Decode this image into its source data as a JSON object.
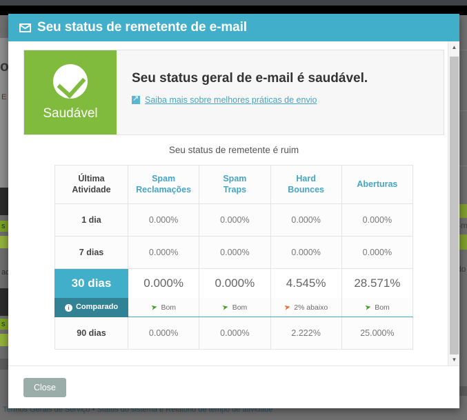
{
  "background": {
    "heading_fragment": "on",
    "sub_fragment": "E",
    "label_s1": "s",
    "label_s2": "s",
    "label_estado": "ade",
    "right_email_label": "E-m",
    "right_estado_label": "tado",
    "footer_text": "Termos Gerais de Serviço • Status do sistema e Relatório de tempo de atividade"
  },
  "modal": {
    "title": "Seu status de remetente de e-mail",
    "title_icon": "envelope-icon",
    "banner": {
      "badge_label": "Saudável",
      "badge_icon": "check-circle-icon",
      "badge_color": "#80bb3e",
      "headline": "Seu status geral de e-mail é saudável.",
      "link_text": "Saiba mais sobre melhores práticas de envio",
      "link_icon": "external-link-icon"
    },
    "sub_status": "Seu status de remetente é ruim",
    "table": {
      "headers": [
        "Última Atividade",
        "Spam Reclamações",
        "Spam Traps",
        "Hard Bounces",
        "Aberturas"
      ],
      "headers_split": [
        [
          "Última",
          "Atividade"
        ],
        [
          "Spam",
          "Reclamações"
        ],
        [
          "Spam",
          "Traps"
        ],
        [
          "Hard",
          "Bounces"
        ],
        [
          "Aberturas",
          ""
        ]
      ],
      "rows": [
        {
          "label": "1 dia",
          "values": [
            "0.000%",
            "0.000%",
            "0.000%",
            "0.000%"
          ]
        },
        {
          "label": "7 dias",
          "values": [
            "0.000%",
            "0.000%",
            "0.000%",
            "0.000%"
          ]
        },
        {
          "label": "30 dias",
          "values": [
            "0.000%",
            "0.000%",
            "4.545%",
            "28.571%"
          ],
          "highlight": true
        },
        {
          "label": "90 dias",
          "values": [
            "0.000%",
            "0.000%",
            "2.222%",
            "25.000%"
          ]
        }
      ],
      "compare_row": {
        "label": "Comparado",
        "label_icon": "info-circle-icon",
        "cells": [
          {
            "text": "Bom",
            "direction": "up",
            "color": "#4a9e2f"
          },
          {
            "text": "Bom",
            "direction": "up",
            "color": "#4a9e2f"
          },
          {
            "text": "2% abaixo",
            "direction": "down",
            "color": "#ef6c2a"
          },
          {
            "text": "Bom",
            "direction": "up",
            "color": "#4a9e2f"
          }
        ]
      }
    },
    "footer": {
      "close_label": "Close"
    },
    "scrollbar": {
      "up_glyph": "▲",
      "down_glyph": "▼"
    },
    "accent_color": "#41afc9",
    "accent_dark": "#328296"
  }
}
